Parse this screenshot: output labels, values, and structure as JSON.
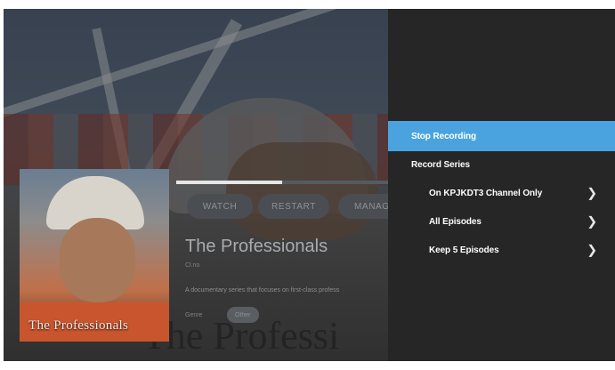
{
  "detail": {
    "actions": {
      "watch": "WATCH",
      "restart": "RESTART",
      "manage": "MANAG"
    },
    "title": "The Professionals",
    "rating": "Cl.no",
    "description": "A documentary series that focuses on first-class profess",
    "genre_label": "Genre",
    "genre_chip": "Other",
    "poster_title": "The Professionals",
    "background_title": "The Professi",
    "progress": 0.5
  },
  "menu": {
    "items": [
      {
        "label": "Stop Recording",
        "selected": true,
        "level": "top",
        "has_submenu": false
      },
      {
        "label": "Record Series",
        "selected": false,
        "level": "top",
        "has_submenu": false
      },
      {
        "label": "On KPJKDT3 Channel Only",
        "selected": false,
        "level": "sub",
        "has_submenu": true
      },
      {
        "label": "All Episodes",
        "selected": false,
        "level": "sub",
        "has_submenu": true
      },
      {
        "label": "Keep 5 Episodes",
        "selected": false,
        "level": "sub",
        "has_submenu": true
      }
    ],
    "chevron_icon": "chevron-right-icon",
    "accent_color": "#4aa3df"
  }
}
